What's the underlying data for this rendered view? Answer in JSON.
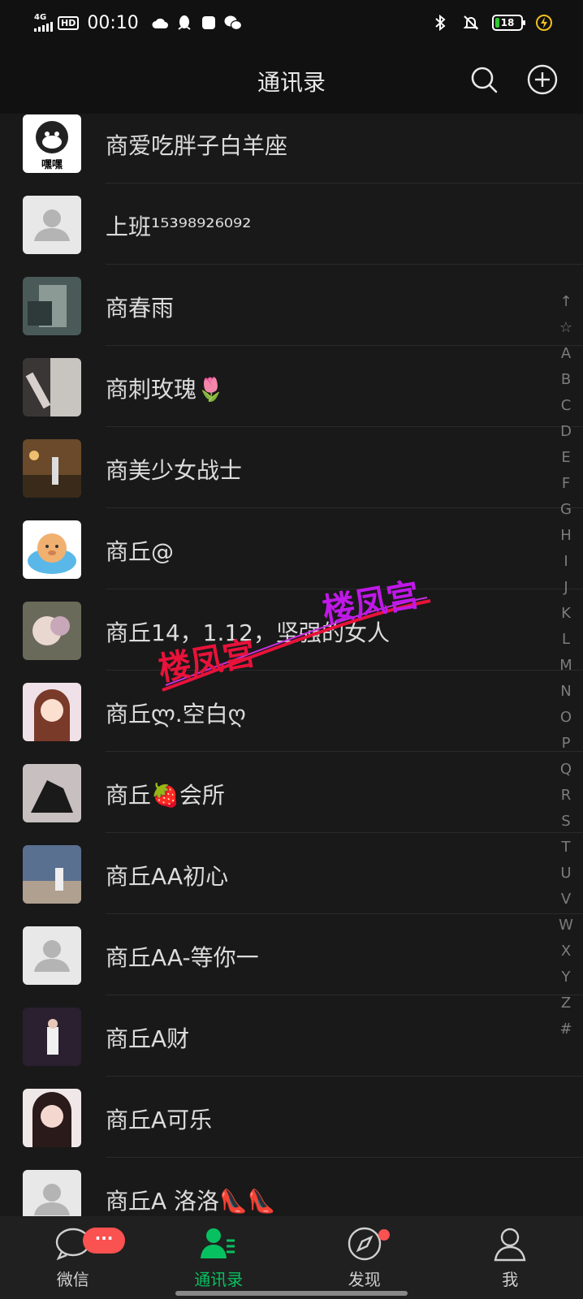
{
  "status_bar": {
    "network": "4G",
    "hd": "HD",
    "time": "00:10",
    "battery": "18"
  },
  "header": {
    "title": "通讯录"
  },
  "contacts": [
    {
      "name": "商爱吃胖子白羊座",
      "avatar_label": "嘿嘿"
    },
    {
      "name": "上班¹⁵³⁹⁸⁹²⁶⁰⁹²"
    },
    {
      "name": "商春雨"
    },
    {
      "name": "商刺玫瑰🌷"
    },
    {
      "name": "商美少女战士"
    },
    {
      "name": "商丘@"
    },
    {
      "name": "商丘14，1.12，坚强的女人"
    },
    {
      "name": "商丘ლ.空白ღ"
    },
    {
      "name": "商丘🍓会所"
    },
    {
      "name": "商丘AA初心"
    },
    {
      "name": "商丘AA-等你一"
    },
    {
      "name": "商丘A财"
    },
    {
      "name": "商丘A可乐"
    },
    {
      "name": "商丘A 洛洛👠👠"
    }
  ],
  "index_bar": [
    "↑",
    "☆",
    "A",
    "B",
    "C",
    "D",
    "E",
    "F",
    "G",
    "H",
    "I",
    "J",
    "K",
    "L",
    "M",
    "N",
    "O",
    "P",
    "Q",
    "R",
    "S",
    "T",
    "U",
    "V",
    "W",
    "X",
    "Y",
    "Z",
    "#"
  ],
  "watermark": {
    "text": "楼凤宫"
  },
  "bottom_nav": {
    "items": [
      {
        "label": "微信",
        "icon": "chat-icon",
        "badge": "···"
      },
      {
        "label": "通讯录",
        "icon": "contacts-icon"
      },
      {
        "label": "发现",
        "icon": "compass-icon"
      },
      {
        "label": "我",
        "icon": "profile-icon"
      }
    ]
  },
  "colors": {
    "accent": "#07c160",
    "badge": "#fa5151",
    "background": "#191919"
  }
}
